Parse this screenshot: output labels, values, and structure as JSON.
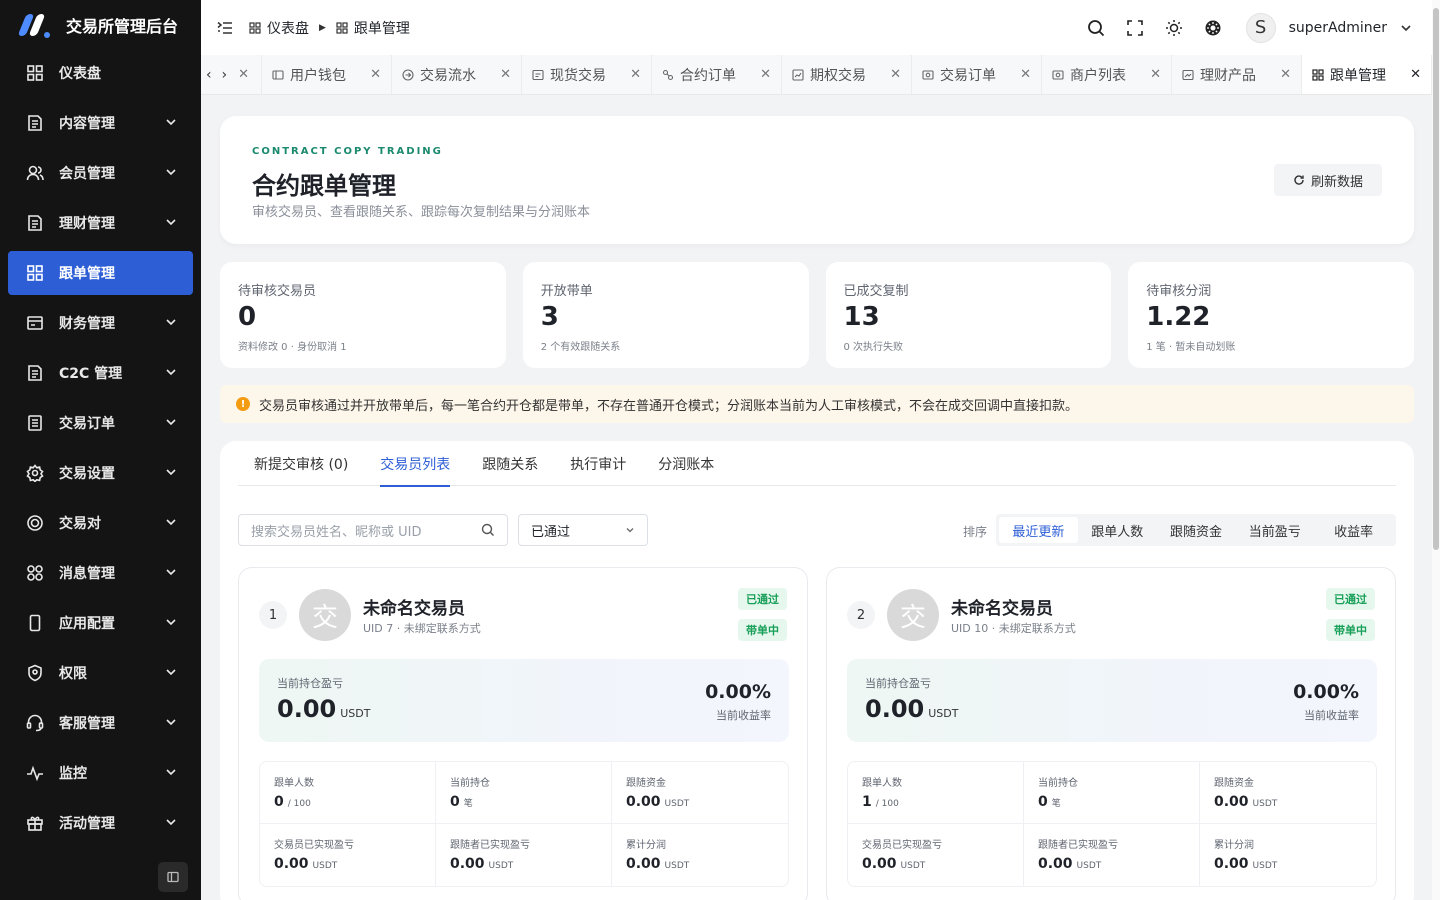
{
  "app": {
    "title": "交易所管理后台"
  },
  "sidebar": {
    "items": [
      {
        "label": "仪表盘",
        "icon": "grid-icon",
        "caret": false
      },
      {
        "label": "内容管理",
        "icon": "document-icon",
        "caret": true
      },
      {
        "label": "会员管理",
        "icon": "users-icon",
        "caret": true
      },
      {
        "label": "理财管理",
        "icon": "document-icon",
        "caret": true
      },
      {
        "label": "跟单管理",
        "icon": "grid-icon",
        "caret": false,
        "active": true
      },
      {
        "label": "财务管理",
        "icon": "wallet-icon",
        "caret": true
      },
      {
        "label": "C2C 管理",
        "icon": "document-icon",
        "caret": true
      },
      {
        "label": "交易订单",
        "icon": "list-icon",
        "caret": true
      },
      {
        "label": "交易设置",
        "icon": "gear-icon",
        "caret": true
      },
      {
        "label": "交易对",
        "icon": "coin-icon",
        "caret": true
      },
      {
        "label": "消息管理",
        "icon": "circles-icon",
        "caret": true
      },
      {
        "label": "应用配置",
        "icon": "phone-icon",
        "caret": true
      },
      {
        "label": "权限",
        "icon": "shield-icon",
        "caret": true
      },
      {
        "label": "客服管理",
        "icon": "headset-icon",
        "caret": true
      },
      {
        "label": "监控",
        "icon": "pulse-icon",
        "caret": true
      },
      {
        "label": "活动管理",
        "icon": "gift-icon",
        "caret": true
      }
    ]
  },
  "header": {
    "breadcrumb": [
      "仪表盘",
      "跟单管理"
    ],
    "user": {
      "initial": "S",
      "name": "superAdminer"
    }
  },
  "tabs": [
    {
      "label": "用户钱包",
      "icon": "wallet-icon"
    },
    {
      "label": "交易流水",
      "icon": "flow-icon"
    },
    {
      "label": "现货交易",
      "icon": "spot-icon"
    },
    {
      "label": "合约订单",
      "icon": "contract-icon"
    },
    {
      "label": "期权交易",
      "icon": "chart-icon"
    },
    {
      "label": "交易订单",
      "icon": "order-icon"
    },
    {
      "label": "商户列表",
      "icon": "merchant-icon"
    },
    {
      "label": "理财产品",
      "icon": "product-icon"
    },
    {
      "label": "跟单管理",
      "icon": "grid-icon",
      "active": true
    }
  ],
  "hero": {
    "eyebrow": "CONTRACT COPY TRADING",
    "title": "合约跟单管理",
    "subtitle": "审核交易员、查看跟随关系、跟踪每次复制结果与分润账本",
    "refresh_label": "刷新数据"
  },
  "stats": [
    {
      "label": "待审核交易员",
      "value": "0",
      "note": "资料修改 0 · 身份取消 1"
    },
    {
      "label": "开放带单",
      "value": "3",
      "note": "2 个有效跟随关系"
    },
    {
      "label": "已成交复制",
      "value": "13",
      "note": "0 次执行失败"
    },
    {
      "label": "待审核分润",
      "value": "1.22",
      "note": "1 笔 · 暂未自动划账"
    }
  ],
  "notice": {
    "text": "交易员审核通过并开放带单后，每一笔合约开仓都是带单，不存在普通开仓模式；分润账本当前为人工审核模式，不会在成交回调中直接扣款。",
    "color": "#f39c12"
  },
  "subtabs": [
    {
      "label": "新提交审核 (0)"
    },
    {
      "label": "交易员列表",
      "active": true
    },
    {
      "label": "跟随关系"
    },
    {
      "label": "执行审计"
    },
    {
      "label": "分润账本"
    }
  ],
  "filters": {
    "search_placeholder": "搜索交易员姓名、昵称或 UID",
    "status_value": "已通过",
    "sort_label": "排序",
    "sort_options": [
      {
        "label": "最近更新",
        "active": true
      },
      {
        "label": "跟单人数"
      },
      {
        "label": "跟随资金"
      },
      {
        "label": "当前盈亏"
      },
      {
        "label": "收益率"
      }
    ]
  },
  "traders": [
    {
      "rank": "1",
      "avatar_char": "交",
      "name": "未命名交易员",
      "uid_line": "UID 7 · 未绑定联系方式",
      "badges": [
        "已通过",
        "带单中"
      ],
      "pnl_label": "当前持仓盈亏",
      "pnl_value": "0.00",
      "pnl_unit": "USDT",
      "rate_value": "0.00%",
      "rate_label": "当前收益率",
      "metrics": [
        {
          "label": "跟单人数",
          "value": "0",
          "unit": "/ 100"
        },
        {
          "label": "当前持仓",
          "value": "0",
          "unit": "笔"
        },
        {
          "label": "跟随资金",
          "value": "0.00",
          "unit": "USDT"
        },
        {
          "label": "交易员已实现盈亏",
          "value": "0.00",
          "unit": "USDT"
        },
        {
          "label": "跟随者已实现盈亏",
          "value": "0.00",
          "unit": "USDT"
        },
        {
          "label": "累计分润",
          "value": "0.00",
          "unit": "USDT"
        }
      ]
    },
    {
      "rank": "2",
      "avatar_char": "交",
      "name": "未命名交易员",
      "uid_line": "UID 10 · 未绑定联系方式",
      "badges": [
        "已通过",
        "带单中"
      ],
      "pnl_label": "当前持仓盈亏",
      "pnl_value": "0.00",
      "pnl_unit": "USDT",
      "rate_value": "0.00%",
      "rate_label": "当前收益率",
      "metrics": [
        {
          "label": "跟单人数",
          "value": "1",
          "unit": "/ 100"
        },
        {
          "label": "当前持仓",
          "value": "0",
          "unit": "笔"
        },
        {
          "label": "跟随资金",
          "value": "0.00",
          "unit": "USDT"
        },
        {
          "label": "交易员已实现盈亏",
          "value": "0.00",
          "unit": "USDT"
        },
        {
          "label": "跟随者已实现盈亏",
          "value": "0.00",
          "unit": "USDT"
        },
        {
          "label": "累计分润",
          "value": "0.00",
          "unit": "USDT"
        }
      ]
    }
  ],
  "colors": {
    "accent": "#2d5ed6",
    "sidebar_bg": "#141414",
    "success": "#18a058",
    "eyebrow": "#1a8a6e"
  }
}
